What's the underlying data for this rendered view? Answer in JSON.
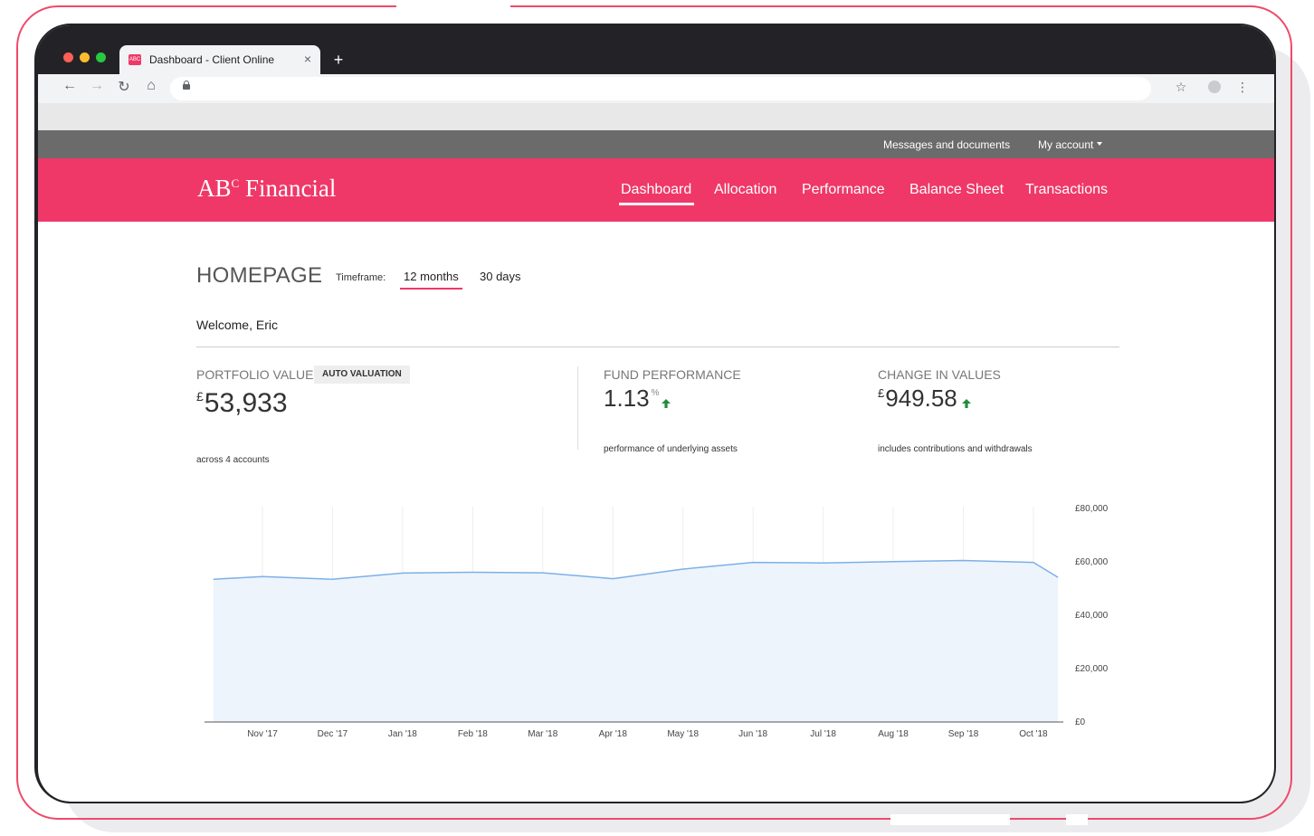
{
  "browser": {
    "tab_title": "Dashboard - Client Online",
    "tab_close": "×",
    "new_tab": "+",
    "favicon_text": "ABC"
  },
  "utility_nav": {
    "messages": "Messages and documents",
    "account": "My account"
  },
  "brand": {
    "name_main": "AB",
    "name_sup": "C",
    "name_rest": " Financial"
  },
  "main_nav": [
    {
      "label": "Dashboard",
      "active": true
    },
    {
      "label": "Allocation"
    },
    {
      "label": "Performance"
    },
    {
      "label": "Balance Sheet"
    },
    {
      "label": "Transactions"
    }
  ],
  "page": {
    "title": "HOMEPAGE",
    "timeframe_label": "Timeframe:",
    "timeframes": [
      {
        "label": "12 months",
        "active": true
      },
      {
        "label": "30 days"
      }
    ],
    "welcome": "Welcome, Eric"
  },
  "kpis": {
    "portfolio": {
      "label": "PORTFOLIO VALUE",
      "badge": "AUTO VALUATION",
      "currency": "£",
      "value": "53,933",
      "sub": "across 4 accounts"
    },
    "fund": {
      "label": "FUND PERFORMANCE",
      "value": "1.13",
      "unit": "%",
      "sub": "performance of underlying assets"
    },
    "change": {
      "label": "CHANGE IN VALUES",
      "currency": "£",
      "value": "949.58",
      "sub": "includes contributions and withdrawals"
    },
    "up_color": "#1e8e3e"
  },
  "chart_data": {
    "type": "area",
    "x": [
      "Nov '17",
      "Dec '17",
      "Jan '18",
      "Feb '18",
      "Mar '18",
      "Apr '18",
      "May '18",
      "Jun '18",
      "Jul '18",
      "Aug '18",
      "Sep '18",
      "Oct '18"
    ],
    "y_ticks": [
      "£80,000",
      "£60,000",
      "£40,000",
      "£20,000",
      "£0"
    ],
    "ylim": [
      0,
      80000
    ],
    "series": [
      {
        "x_index": [
          -0.7,
          0,
          1,
          2,
          3,
          4,
          5,
          6,
          7,
          8,
          9,
          10,
          11,
          11.35
        ],
        "values": [
          53500,
          54500,
          53500,
          55800,
          56100,
          55900,
          53700,
          57300,
          59800,
          59600,
          60100,
          60500,
          59800,
          54200
        ]
      }
    ],
    "line_color": "#7cb0e8",
    "fill_color": "#eef4fc",
    "grid": true
  }
}
